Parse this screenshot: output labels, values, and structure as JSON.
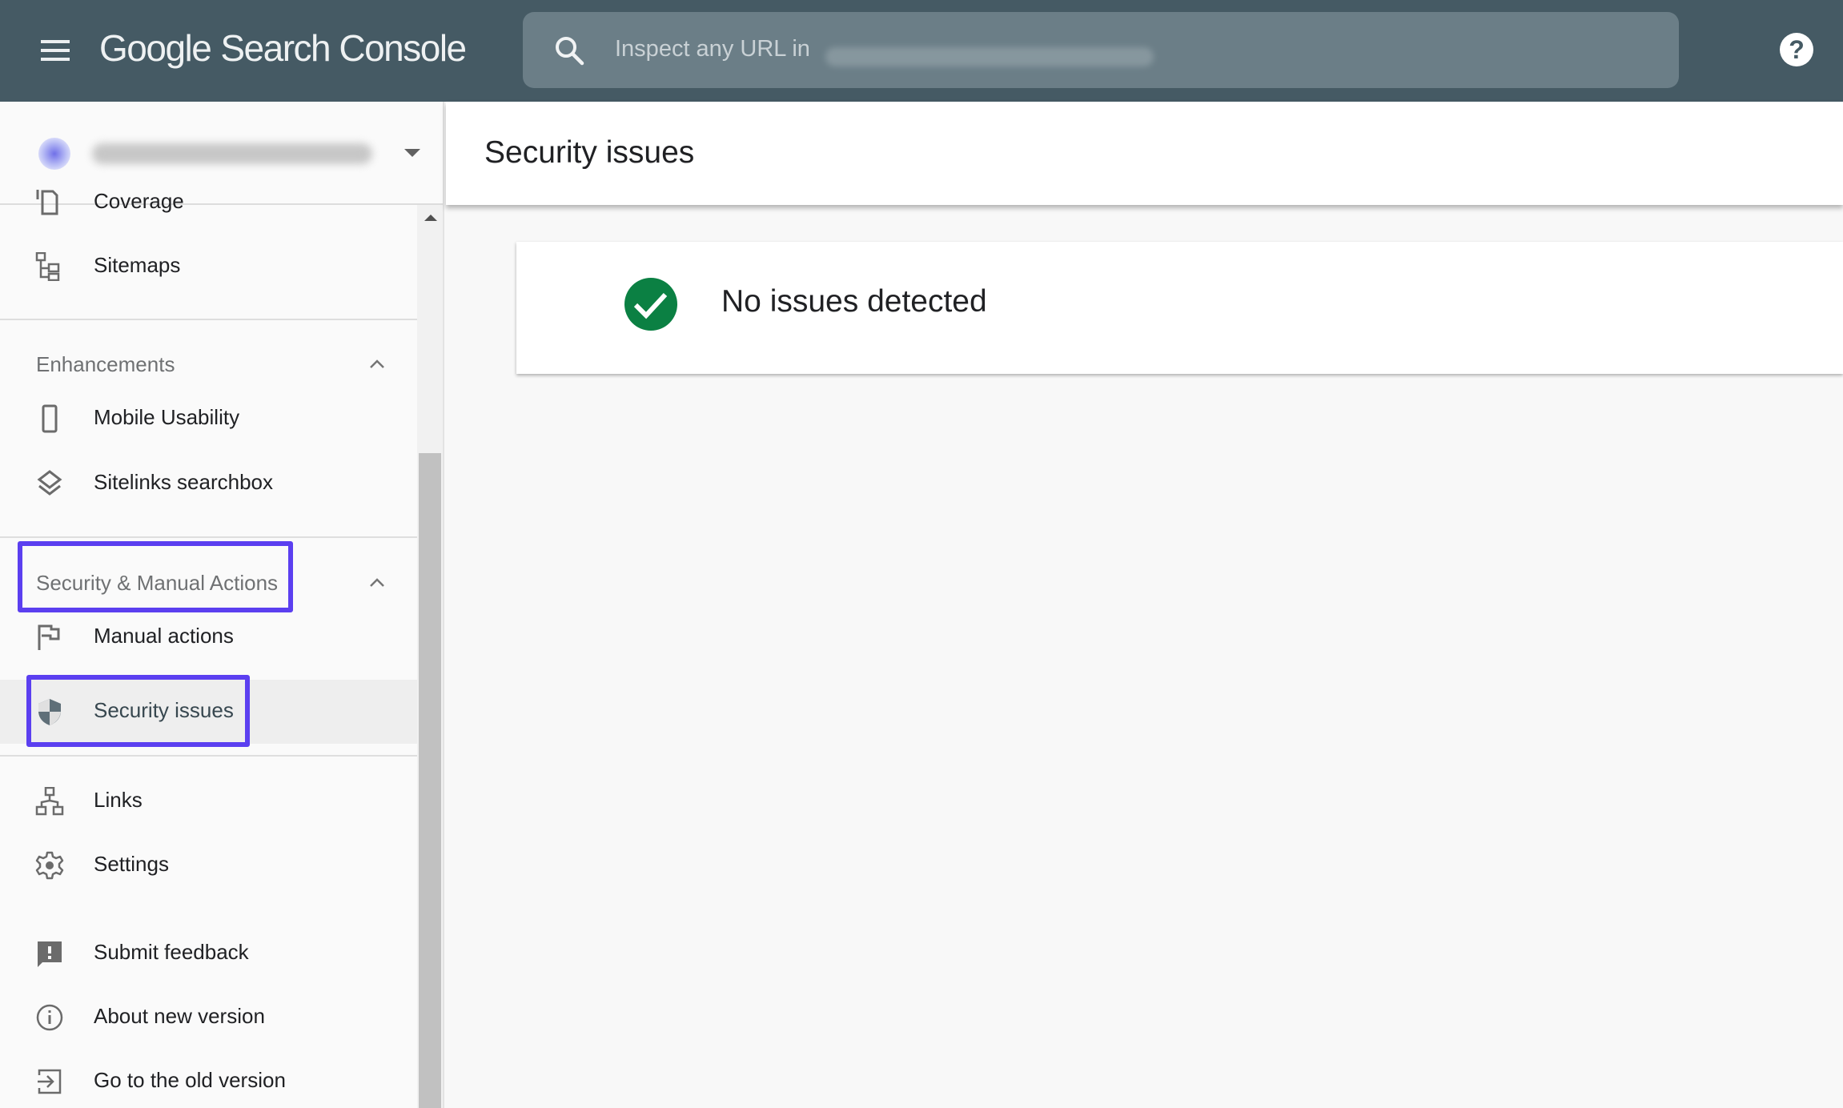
{
  "header": {
    "logo_google": "Google",
    "logo_product": "Search Console",
    "search_placeholder": "Inspect any URL in",
    "help_label": "?"
  },
  "property_selector": {
    "url": "(blurred property URL)"
  },
  "sidebar": {
    "items_top": [
      {
        "label": "Coverage",
        "icon": "coverage-icon"
      },
      {
        "label": "Sitemaps",
        "icon": "sitemap-icon"
      }
    ],
    "enhancements": {
      "label": "Enhancements",
      "expanded": true,
      "items": [
        {
          "label": "Mobile Usability",
          "icon": "mobile-phone-icon"
        },
        {
          "label": "Sitelinks searchbox",
          "icon": "layers-icon"
        }
      ]
    },
    "security": {
      "label": "Security & Manual Actions",
      "expanded": true,
      "highlighted": true,
      "items": [
        {
          "label": "Manual actions",
          "icon": "flag-icon"
        },
        {
          "label": "Security issues",
          "icon": "shield-icon",
          "active": true,
          "highlighted": true
        }
      ]
    },
    "items_bottom": [
      {
        "label": "Links",
        "icon": "links-icon"
      },
      {
        "label": "Settings",
        "icon": "gear-icon"
      }
    ],
    "footer_items": [
      {
        "label": "Submit feedback",
        "icon": "feedback-icon"
      },
      {
        "label": "About new version",
        "icon": "info-icon"
      },
      {
        "label": "Go to the old version",
        "icon": "exit-to-old-icon"
      }
    ]
  },
  "main": {
    "page_title": "Security issues",
    "status_card": {
      "message": "No issues detected",
      "status": "ok",
      "icon": "check-circle-icon"
    }
  },
  "colors": {
    "header_bg": "#455a64",
    "success_green": "#0b8043",
    "highlight_box": "#5b3ff0"
  }
}
